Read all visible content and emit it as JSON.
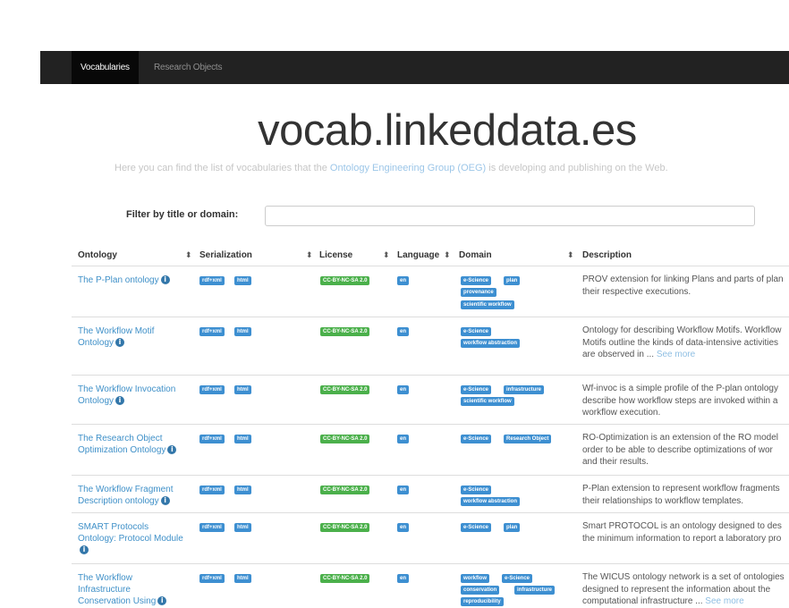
{
  "nav": {
    "items": [
      {
        "label": "Vocabularies",
        "active": true
      },
      {
        "label": "Research Objects",
        "active": false
      }
    ]
  },
  "header": {
    "title": "vocab.linkeddata.es",
    "subtitle_pre": "Here you can find the list of vocabularies that the ",
    "subtitle_link": "Ontology Engineering Group (OEG)",
    "subtitle_post": " is developing and publishing on the Web."
  },
  "filter": {
    "label": "Filter by title or domain:",
    "placeholder": "",
    "value": ""
  },
  "table": {
    "headers": [
      "Ontology",
      "Serialization",
      "License",
      "Language",
      "Domain",
      "Description"
    ],
    "sort_icon": "⬍",
    "info_icon": "i",
    "rows": [
      {
        "name_lines": [
          "The P-Plan ontology"
        ],
        "serialization": [
          "rdf+xml",
          "html"
        ],
        "license": "CC-BY-NC-SA 2.0",
        "language": "en",
        "domain": [
          "e-Science",
          "plan",
          "provenance",
          "scientific workflow"
        ],
        "desc_lines": [
          "PROV extension for linking Plans and parts of plan",
          "their respective executions."
        ],
        "more": ""
      },
      {
        "name_lines": [
          "The Workflow Motif",
          "Ontology"
        ],
        "serialization": [
          "rdf+xml",
          "html"
        ],
        "license": "CC-BY-NC-SA 2.0",
        "language": "en",
        "domain": [
          "e-Science",
          "workflow abstraction"
        ],
        "desc_lines": [
          "Ontology for describing Workflow Motifs. Workflow",
          "Motifs outline the kinds of data-intensive activities",
          "are observed in ... "
        ],
        "more": "See more"
      },
      {
        "name_lines": [
          "The Workflow Invocation",
          "Ontology"
        ],
        "serialization": [
          "rdf+xml",
          "html"
        ],
        "license": "CC-BY-NC-SA 2.0",
        "language": "en",
        "domain": [
          "e-Science",
          "infrastructure",
          "scientific workflow"
        ],
        "desc_lines": [
          "Wf-invoc is a simple profile of the P-plan ontology",
          "describe how workflow steps are invoked within a",
          "workflow execution."
        ],
        "more": ""
      },
      {
        "name_lines": [
          "The Research Object",
          "Optimization Ontology"
        ],
        "serialization": [
          "rdf+xml",
          "html"
        ],
        "license": "CC-BY-NC-SA 2.0",
        "language": "en",
        "domain": [
          "e-Science",
          "Research Object"
        ],
        "desc_lines": [
          "RO-Optimization is an extension of the RO model",
          "order to be able to describe optimizations of wor",
          "and their results."
        ],
        "more": ""
      },
      {
        "name_lines": [
          "The Workflow Fragment",
          "Description ontology"
        ],
        "serialization": [
          "rdf+xml",
          "html"
        ],
        "license": "CC-BY-NC-SA 2.0",
        "language": "en",
        "domain": [
          "e-Science",
          "workflow abstraction"
        ],
        "desc_lines": [
          "P-Plan extension to represent workflow fragments",
          "their relationships to workflow templates."
        ],
        "more": ""
      },
      {
        "name_lines": [
          "SMART Protocols",
          "Ontology: Protocol Module"
        ],
        "serialization": [
          "rdf+xml",
          "html"
        ],
        "license": "CC-BY-NC-SA 2.0",
        "language": "en",
        "domain": [
          "e-Science",
          "plan"
        ],
        "desc_lines": [
          "Smart PROTOCOL is an ontology designed to des",
          "the minimum information to report a laboratory pro"
        ],
        "more": ""
      },
      {
        "name_lines": [
          "The Workflow",
          "Infrastructure",
          "Conservation Using"
        ],
        "serialization": [
          "rdf+xml",
          "html"
        ],
        "license": "CC-BY-NC-SA 2.0",
        "language": "en",
        "domain": [
          "workflow",
          "e-Science",
          "conservation",
          "infrastructure",
          "reproducibility"
        ],
        "desc_lines": [
          "The WICUS ontology network is a set of ontologies",
          "designed to represent the information about the",
          "computational infrastructure ... "
        ],
        "more": "See more"
      }
    ]
  },
  "colors": {
    "navbar": "#222222",
    "link": "#3f90c8",
    "badge_blue": "#3d8fd1",
    "badge_green": "#4bb04b"
  }
}
